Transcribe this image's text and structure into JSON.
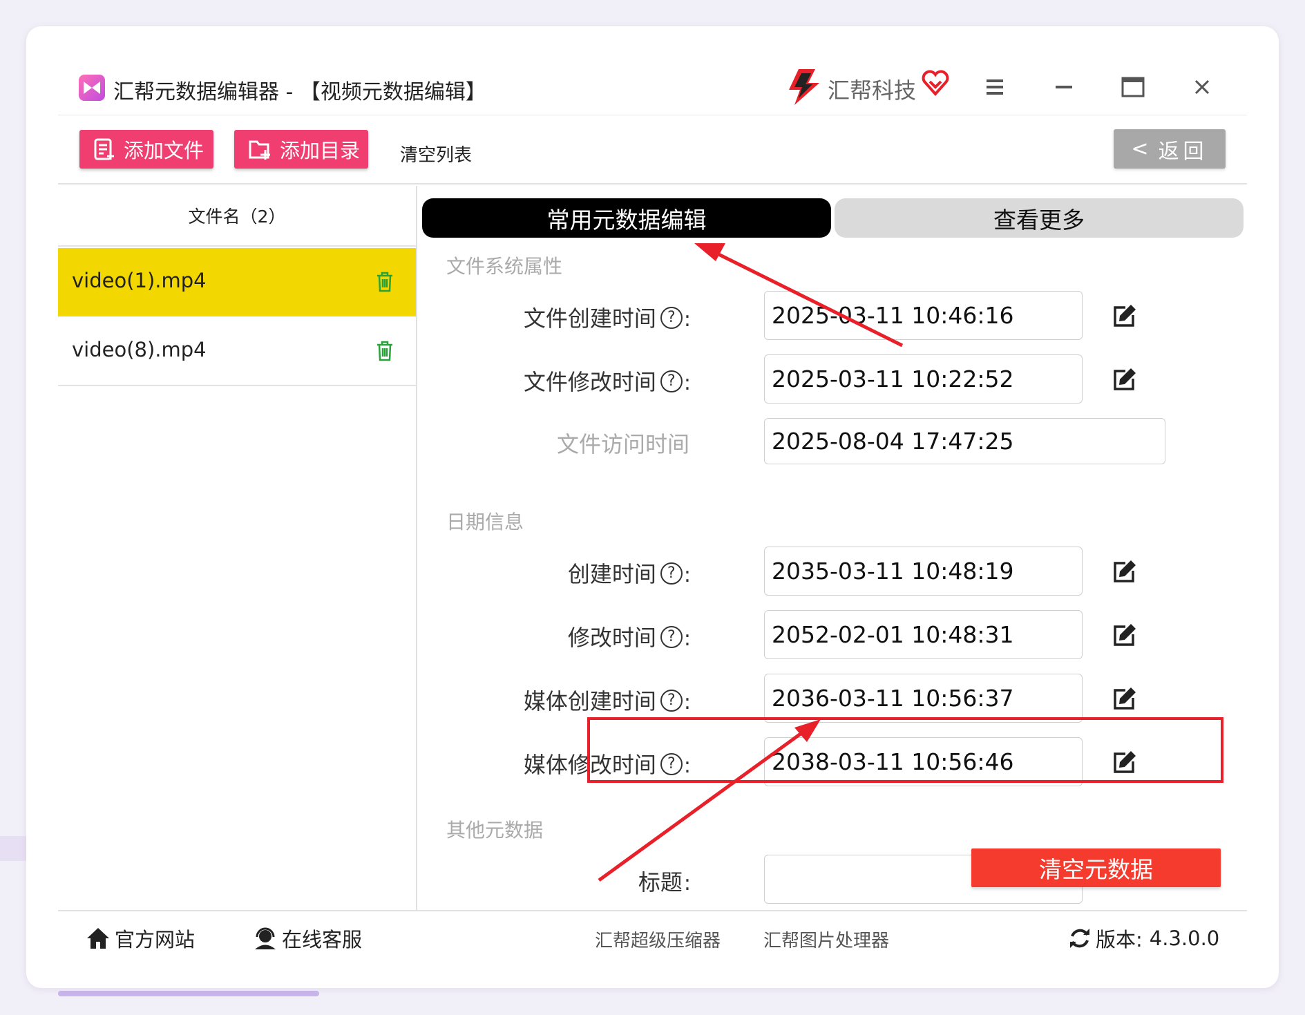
{
  "title": {
    "app_name": "汇帮元数据编辑器 - 【视频元数据编辑】",
    "brand": "汇帮科技"
  },
  "toolbar": {
    "add_file": "添加文件",
    "add_folder": "添加目录",
    "clear_list": "清空列表",
    "back": "返回",
    "back_icon": "<"
  },
  "file_list": {
    "header": "文件名（2）",
    "items": [
      {
        "name": "video(1).mp4",
        "selected": true
      },
      {
        "name": "video(8).mp4",
        "selected": false
      }
    ]
  },
  "tabs": {
    "common": "常用元数据编辑",
    "more": "查看更多"
  },
  "sections": {
    "fs": {
      "title": "文件系统属性",
      "fields": [
        {
          "label": "文件创建时间",
          "value": "2025-03-11 10:46:16",
          "has_help": true,
          "editable": true
        },
        {
          "label": "文件修改时间",
          "value": "2025-03-11 10:22:52",
          "has_help": true,
          "editable": true
        },
        {
          "label": "文件访问时间",
          "value": "2025-08-04 17:47:25",
          "has_help": false,
          "editable": false
        }
      ]
    },
    "date": {
      "title": "日期信息",
      "fields": [
        {
          "label": "创建时间",
          "value": "2035-03-11 10:48:19",
          "has_help": true,
          "editable": true
        },
        {
          "label": "修改时间",
          "value": "2052-02-01 10:48:31",
          "has_help": true,
          "editable": true
        },
        {
          "label": "媒体创建时间",
          "value": "2036-03-11 10:56:37",
          "has_help": true,
          "editable": true
        },
        {
          "label": "媒体修改时间",
          "value": "2038-03-11 10:56:46",
          "has_help": true,
          "editable": true
        }
      ]
    },
    "other": {
      "title": "其他元数据",
      "fields": [
        {
          "label": "标题",
          "value": "",
          "has_help": false,
          "editable": false
        }
      ]
    }
  },
  "help_glyph": "?",
  "colon": ":",
  "clear_metadata": "清空元数据",
  "footer": {
    "official_site": "官方网站",
    "online_service": "在线客服",
    "compressor": "汇帮超级压缩器",
    "image_processor": "汇帮图片处理器",
    "version_label": "版本:",
    "version": "4.3.0.0"
  },
  "colors": {
    "accent_pink": "#ef3e6f",
    "selected_row": "#f2d701",
    "danger_red": "#f43b2e",
    "annotation_red": "#e8202a"
  },
  "icons": [
    "app-logo-icon",
    "brand-logo-icon",
    "brand-heart-icon",
    "menu-icon",
    "minimize-icon",
    "maximize-icon",
    "close-icon",
    "add-file-icon",
    "add-folder-icon",
    "trash-icon",
    "help-icon",
    "edit-icon",
    "home-icon",
    "support-icon",
    "refresh-icon"
  ]
}
